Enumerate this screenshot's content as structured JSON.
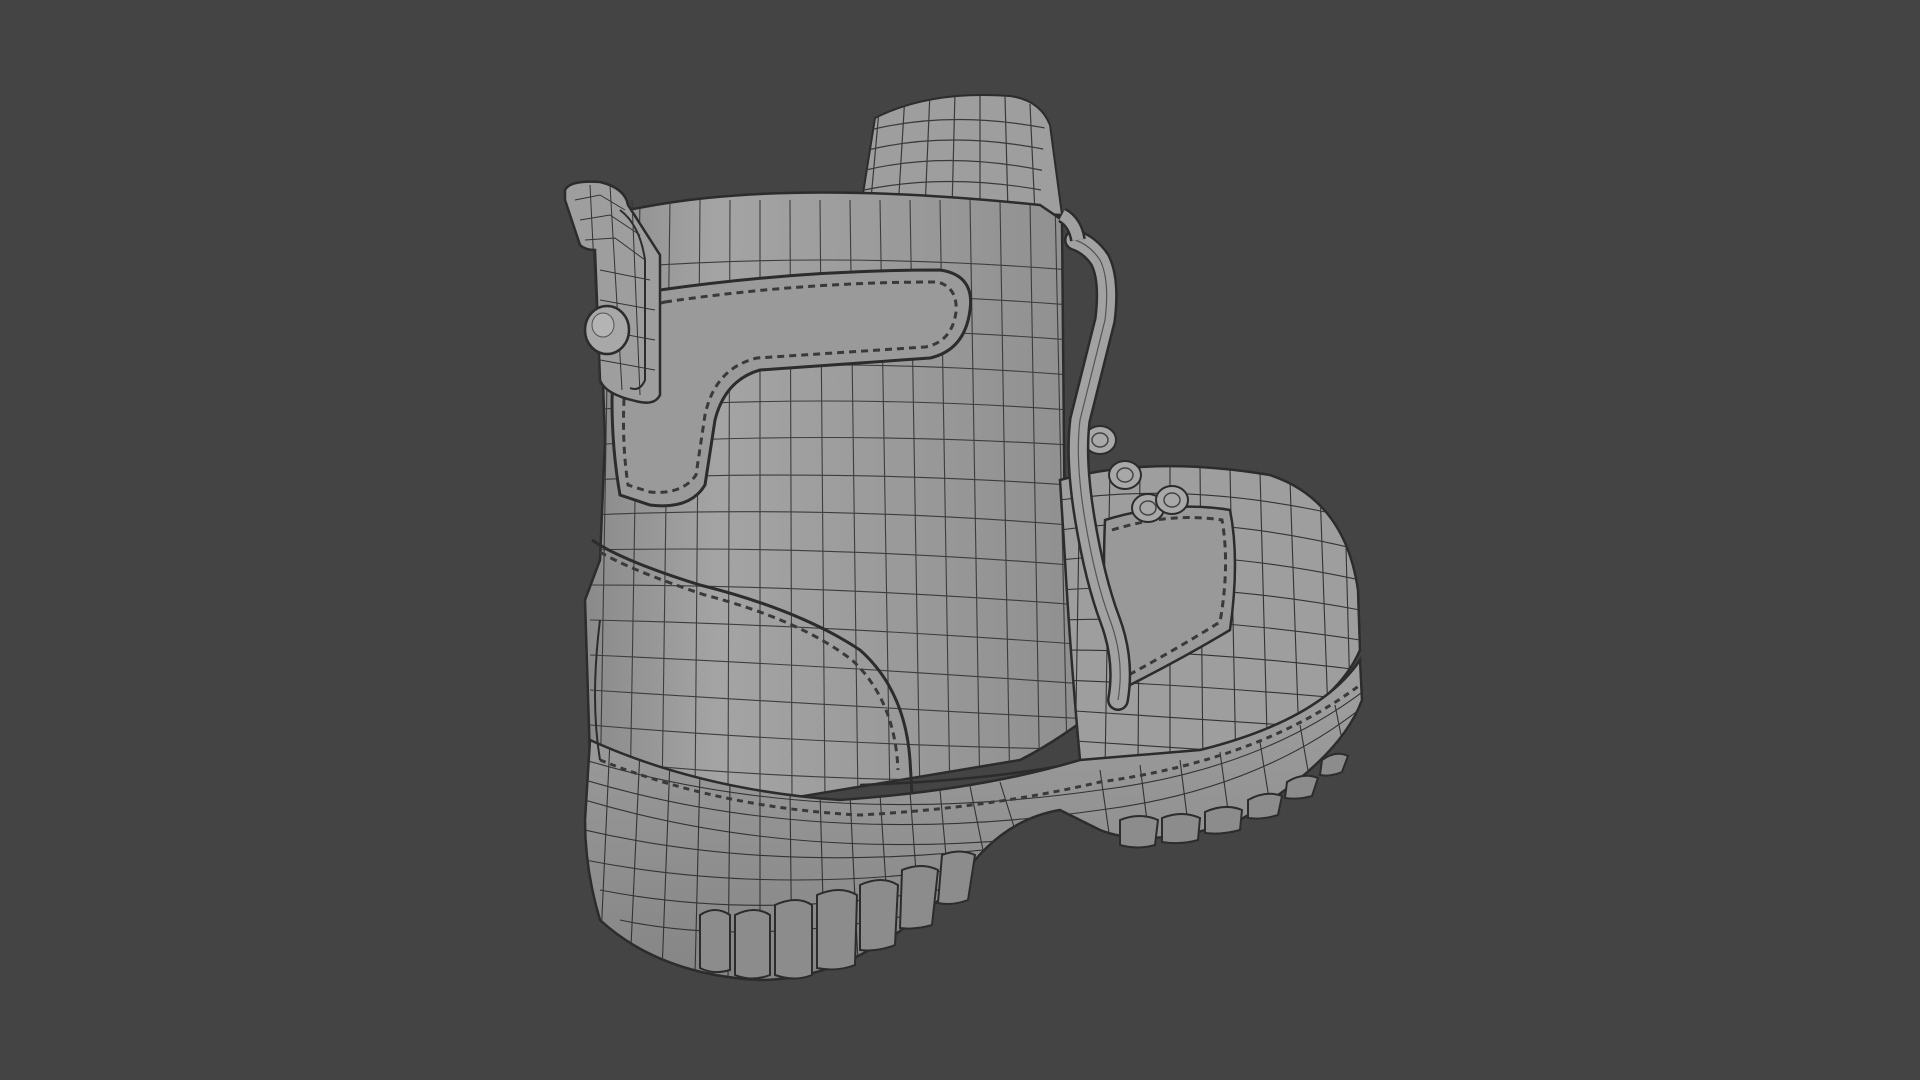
{
  "viewport": {
    "background_color": "#444444",
    "mode": "wireframe-on-shaded"
  },
  "model": {
    "icon": "boot-mesh-icon",
    "surface_color": "#9c9c9c",
    "wire_color": "#2c2c2c",
    "stitch_color": "#3a3a3a"
  }
}
